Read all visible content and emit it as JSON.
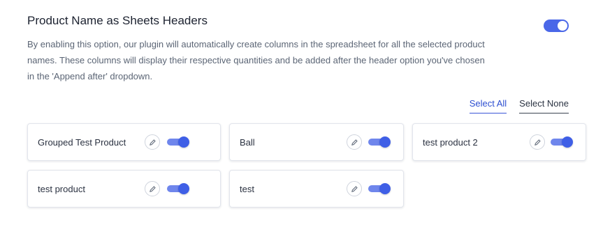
{
  "section": {
    "title": "Product Name as Sheets Headers",
    "description": "By enabling this option, our plugin will automatically create columns in the spreadsheet for all the selected product names. These columns will display their respective quantities and be added after the header option you've chosen in the 'Append after' dropdown.",
    "enabled": true
  },
  "selection": {
    "select_all_label": "Select All",
    "select_none_label": "Select None"
  },
  "products": [
    {
      "name": "Grouped Test Product",
      "enabled": true
    },
    {
      "name": "Ball",
      "enabled": true
    },
    {
      "name": "test product 2",
      "enabled": true
    },
    {
      "name": "test product",
      "enabled": true
    },
    {
      "name": "test",
      "enabled": true
    }
  ],
  "colors": {
    "accent": "#4a67e8",
    "link": "#2e4fd1",
    "description_text": "#5b6575"
  }
}
